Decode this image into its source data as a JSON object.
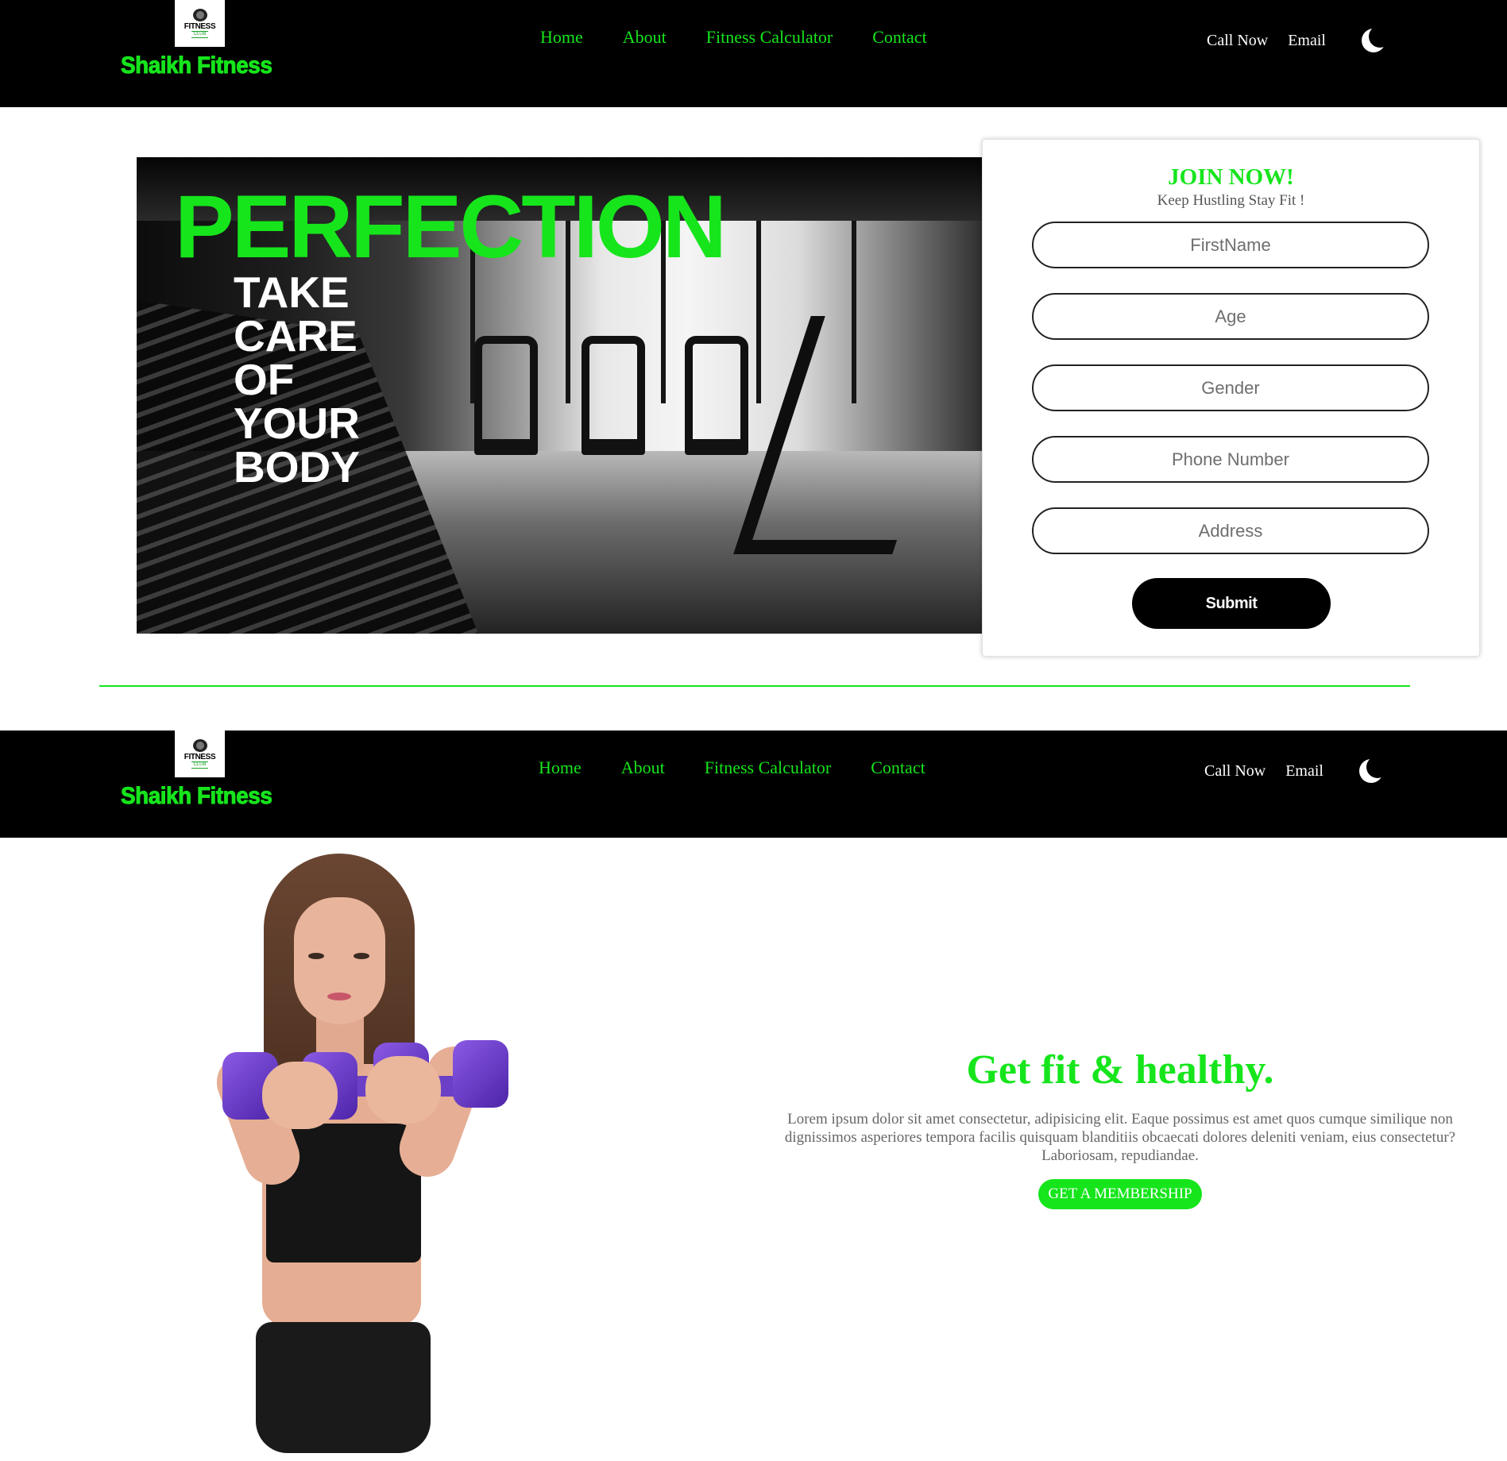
{
  "navbar": {
    "brand": "Shaikh Fitness",
    "logo": {
      "word": "FITNESS",
      "sub": "CLUB",
      "icon": "fitness-club-logo"
    },
    "links": [
      "Home",
      "About",
      "Fitness Calculator",
      "Contact"
    ],
    "call": "Call Now",
    "email": "Email",
    "theme_icon": "moon-icon"
  },
  "hero": {
    "headline": "PERFECTION",
    "subline": "TAKE CARE OF YOUR BODY",
    "image": "gym-interior-photo"
  },
  "join_form": {
    "title": "JOIN NOW!",
    "tagline": "Keep Hustling Stay Fit !",
    "fields": {
      "first_name": "FirstName",
      "age": "Age",
      "gender": "Gender",
      "phone": "Phone Number",
      "address": "Address"
    },
    "submit": "Submit"
  },
  "about": {
    "image": "woman-with-dumbbell-photo",
    "title": "Get fit & healthy.",
    "body": "Lorem ipsum dolor sit amet consectetur, adipisicing elit. Eaque possimus est amet quos cumque similique non dignissimos asperiores tempora facilis quisquam blanditiis obcaecati dolores deleniti veniam, eius consectetur? Laboriosam, repudiandae.",
    "cta": "GET A MEMBERSHIP"
  },
  "colors": {
    "accent": "#16e51c",
    "navbar_bg": "#000000",
    "page_bg": "#ffffff",
    "dumbbell": "#6b3fc6"
  }
}
